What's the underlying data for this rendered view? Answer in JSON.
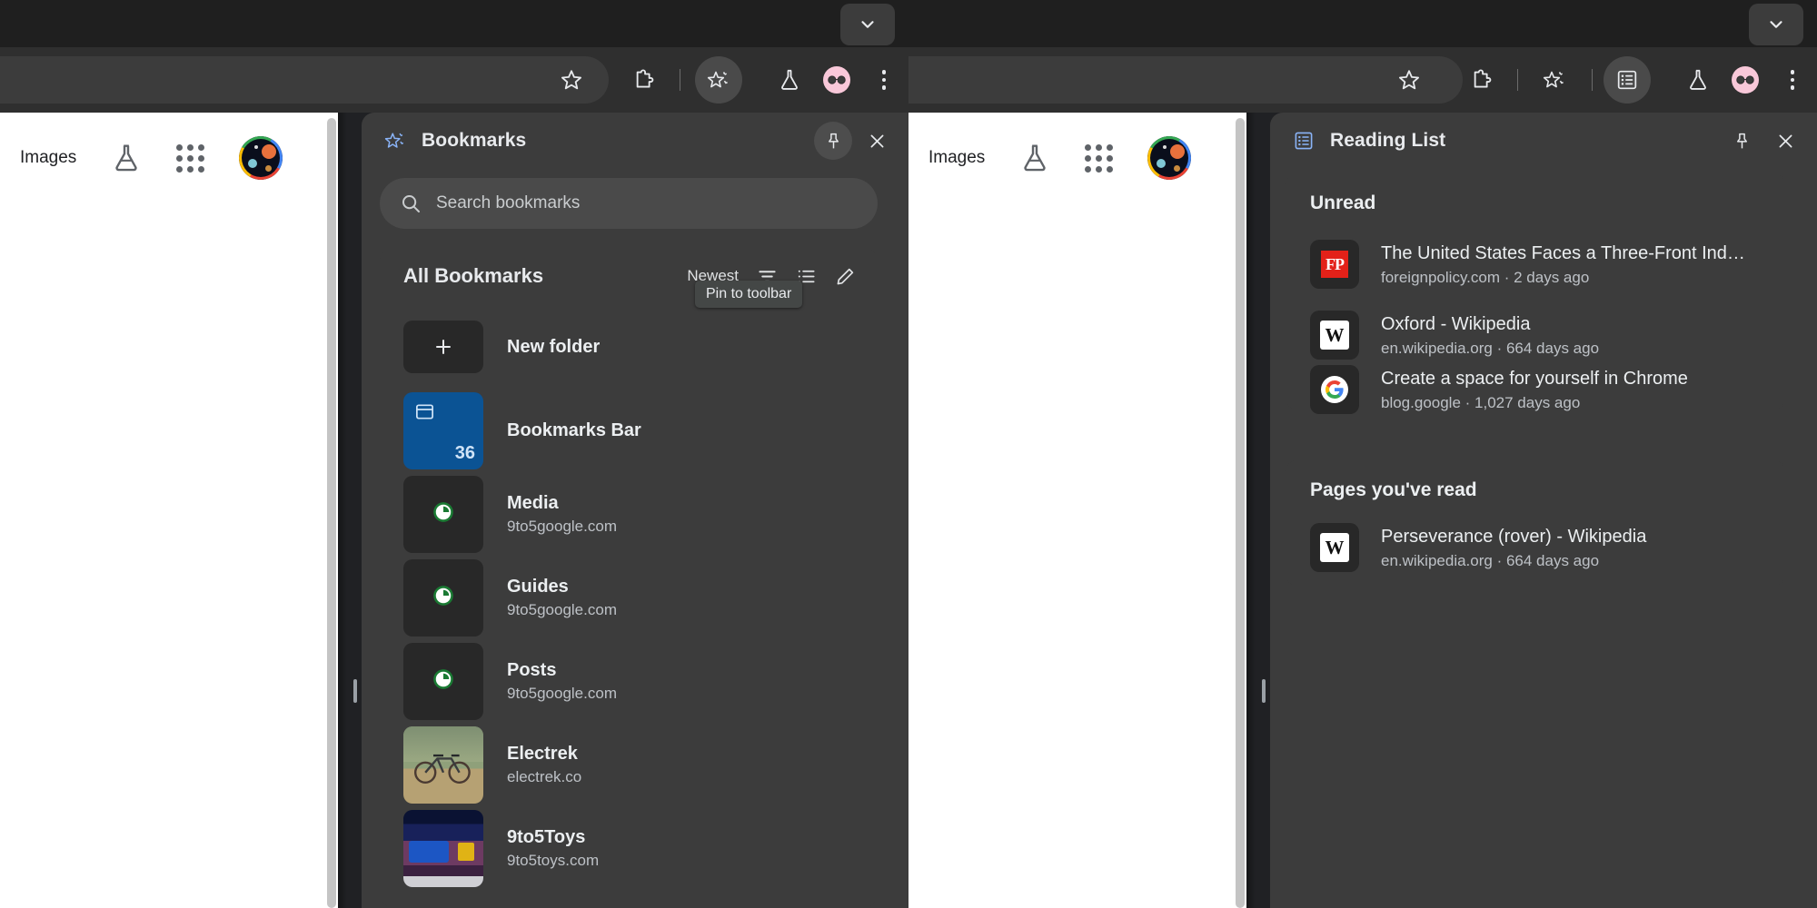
{
  "windows": {
    "left": {
      "page": {
        "images_link": "Images",
        "labs_icon": "flask-icon",
        "apps_icon": "apps-grid-icon",
        "avatar_icon": "profile-avatar"
      },
      "toolbar": {
        "bookmark_star_icon": "star-icon",
        "extensions_icon": "puzzle-extension-icon",
        "bookmarks_panel_icon": "bookmarks-sparkle-icon",
        "labs_icon": "flask-icon",
        "profile_icon": "profile-avatar-icon",
        "menu_icon": "three-dot-menu-icon",
        "tabstrip_chevron_icon": "chevron-down-icon"
      },
      "panel": {
        "title": "Bookmarks",
        "header_icon": "bookmarks-sparkle-icon",
        "pin_icon": "pin-icon",
        "close_icon": "close-icon",
        "tooltip": "Pin to toolbar",
        "search_placeholder": "Search bookmarks",
        "search_icon": "search-icon",
        "card_title": "All Bookmarks",
        "sort_label": "Newest",
        "sort_icon": "sort-filter-icon",
        "view_icon": "list-view-icon",
        "edit_icon": "edit-pencil-icon",
        "new_folder_label": "New folder",
        "new_folder_icon": "plus-icon",
        "items": [
          {
            "title": "Bookmarks Bar",
            "subtitle": "",
            "count": "36",
            "kind": "folder"
          },
          {
            "title": "Media",
            "subtitle": "9to5google.com",
            "kind": "clock"
          },
          {
            "title": "Guides",
            "subtitle": "9to5google.com",
            "kind": "clock"
          },
          {
            "title": "Posts",
            "subtitle": "9to5google.com",
            "kind": "clock"
          },
          {
            "title": "Electrek",
            "subtitle": "electrek.co",
            "kind": "thumb-bike"
          },
          {
            "title": "9to5Toys",
            "subtitle": "9to5toys.com",
            "kind": "thumb-toys"
          }
        ]
      }
    },
    "right": {
      "page": {
        "images_link": "Images",
        "labs_icon": "flask-icon",
        "apps_icon": "apps-grid-icon",
        "avatar_icon": "profile-avatar"
      },
      "toolbar": {
        "bookmark_star_icon": "star-icon",
        "extensions_icon": "puzzle-extension-icon",
        "bookmarks_panel_icon": "bookmarks-sparkle-icon",
        "reading_list_icon": "reading-list-icon",
        "labs_icon": "flask-icon",
        "profile_icon": "profile-avatar-icon",
        "menu_icon": "three-dot-menu-icon",
        "tabstrip_chevron_icon": "chevron-down-icon"
      },
      "panel": {
        "title": "Reading List",
        "header_icon": "reading-list-icon",
        "pin_icon": "pin-icon",
        "close_icon": "close-icon",
        "sections": [
          {
            "heading": "Unread",
            "items": [
              {
                "title": "The United States Faces a Three-Front Ind…",
                "subtitle": "foreignpolicy.com · 2 days ago",
                "favicon": "foreignpolicy-favicon"
              },
              {
                "title": "Oxford - Wikipedia",
                "subtitle": "en.wikipedia.org · 664 days ago",
                "favicon": "wikipedia-favicon"
              },
              {
                "title": "Create a space for yourself in Chrome",
                "subtitle": "blog.google · 1,027 days ago",
                "favicon": "google-favicon"
              }
            ]
          },
          {
            "heading": "Pages you've read",
            "items": [
              {
                "title": "Perseverance (rover) - Wikipedia",
                "subtitle": "en.wikipedia.org · 664 days ago",
                "favicon": "wikipedia-favicon"
              }
            ]
          }
        ]
      }
    }
  },
  "colors": {
    "toolbar_bg": "#2f2f2f",
    "tabstrip_bg": "#1f1f1f",
    "panel_bg": "#3c3c3c",
    "tile_bg": "#282828",
    "folder_blue": "#0b5394",
    "text_primary": "#e8eaed",
    "text_secondary": "#bdc1c6",
    "accent_blue": "#8ab4f8"
  }
}
